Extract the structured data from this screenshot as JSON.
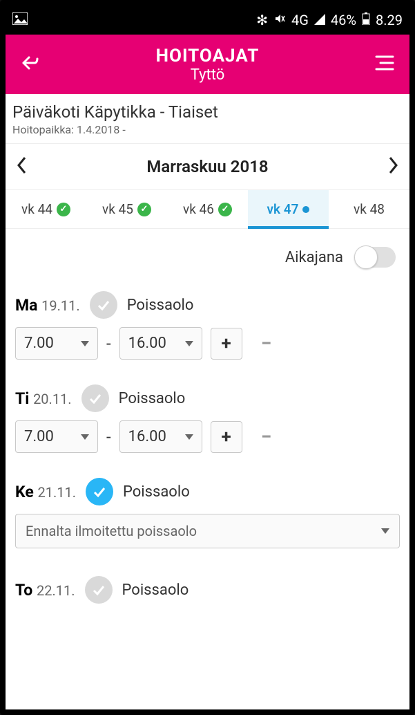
{
  "status": {
    "battery": "46%",
    "time": "8.29",
    "network": "4G"
  },
  "header": {
    "title": "HOITOAJAT",
    "subtitle": "Tyttö"
  },
  "location": {
    "name": "Päiväkoti Käpytikka - Tiaiset",
    "sub": "Hoitopaikka: 1.4.2018 -"
  },
  "month": "Marraskuu 2018",
  "weeks": [
    {
      "label": "vk 44",
      "status": "ok"
    },
    {
      "label": "vk 45",
      "status": "ok"
    },
    {
      "label": "vk 46",
      "status": "ok"
    },
    {
      "label": "vk 47",
      "status": "active"
    },
    {
      "label": "vk 48",
      "status": "none"
    }
  ],
  "timeline_label": "Aikajana",
  "absent_label": "Poissaolo",
  "days": {
    "mon": {
      "dow": "Ma",
      "date": "19.11.",
      "start": "7.00",
      "end": "16.00"
    },
    "tue": {
      "dow": "Ti",
      "date": "20.11.",
      "start": "7.00",
      "end": "16.00"
    },
    "wed": {
      "dow": "Ke",
      "date": "21.11.",
      "reason": "Ennalta ilmoitettu poissaolo"
    },
    "thu": {
      "dow": "To",
      "date": "22.11."
    }
  }
}
